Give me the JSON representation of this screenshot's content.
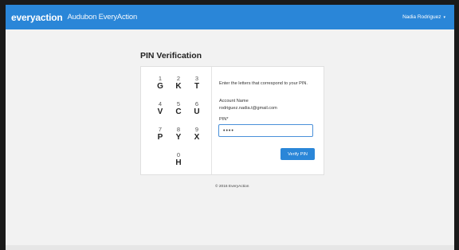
{
  "header": {
    "brand": "everyaction",
    "org_name": "Audubon EveryAction",
    "user_name": "Nadia Rodriguez",
    "user_caret": "▾"
  },
  "page": {
    "title": "PIN Verification"
  },
  "keypad": [
    {
      "num": "1",
      "letter": "G"
    },
    {
      "num": "2",
      "letter": "K"
    },
    {
      "num": "3",
      "letter": "T"
    },
    {
      "num": "4",
      "letter": "V"
    },
    {
      "num": "5",
      "letter": "C"
    },
    {
      "num": "6",
      "letter": "U"
    },
    {
      "num": "7",
      "letter": "P"
    },
    {
      "num": "8",
      "letter": "Y"
    },
    {
      "num": "9",
      "letter": "X"
    },
    {
      "num": "0",
      "letter": "H"
    }
  ],
  "form": {
    "instructions": "Enter the letters that correspond to your PIN.",
    "account_label": "Account Name",
    "account_email": "rodriguez.nadia.t@gmail.com",
    "pin_label": "PIN*",
    "pin_value": "••••",
    "verify_label": "Verify PIN"
  },
  "footer": {
    "copyright": "© 2016 EveryAction"
  },
  "colors": {
    "brand_blue": "#2a86d8",
    "background": "#f2f2f2"
  }
}
